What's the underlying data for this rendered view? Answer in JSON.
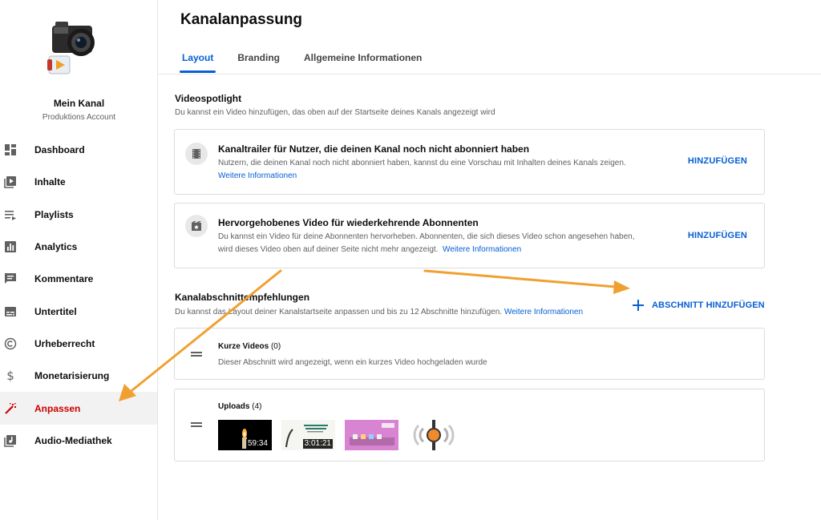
{
  "sidebar": {
    "channel_name": "Mein Kanal",
    "account_type": "Produktions Account",
    "items": [
      {
        "label": "Dashboard",
        "icon": "dashboard-icon"
      },
      {
        "label": "Inhalte",
        "icon": "video-library-icon"
      },
      {
        "label": "Playlists",
        "icon": "playlist-icon"
      },
      {
        "label": "Analytics",
        "icon": "analytics-icon"
      },
      {
        "label": "Kommentare",
        "icon": "comment-icon"
      },
      {
        "label": "Untertitel",
        "icon": "subtitles-icon"
      },
      {
        "label": "Urheberrecht",
        "icon": "copyright-icon"
      },
      {
        "label": "Monetarisierung",
        "icon": "dollar-icon"
      },
      {
        "label": "Anpassen",
        "icon": "magic-wand-icon",
        "active": true
      },
      {
        "label": "Audio-Mediathek",
        "icon": "audio-library-icon"
      }
    ]
  },
  "header": {
    "title": "Kanalanpassung",
    "tabs": [
      {
        "label": "Layout",
        "active": true
      },
      {
        "label": "Branding"
      },
      {
        "label": "Allgemeine Informationen"
      }
    ]
  },
  "spotlight": {
    "title": "Videospotlight",
    "description": "Du kannst ein Video hinzufügen, das oben auf der Startseite deines Kanals angezeigt wird",
    "cards": [
      {
        "title": "Kanaltrailer für Nutzer, die deinen Kanal noch nicht abonniert haben",
        "description": "Nutzern, die deinen Kanal noch nicht abonniert haben, kannst du eine Vorschau mit Inhalten deines Kanals zeigen.",
        "link": "Weitere Informationen",
        "button": "HINZUFÜGEN",
        "icon": "film-icon"
      },
      {
        "title": "Hervorgehobenes Video für wiederkehrende Abonnenten",
        "description_line1": "Du kannst ein Video für deine Abonnenten hervorheben. Abonnenten, die sich dieses Video schon angesehen haben,",
        "description_line2": "wird dieses Video oben auf deiner Seite nicht mehr angezeigt.",
        "link": "Weitere Informationen",
        "button": "HINZUFÜGEN",
        "icon": "featured-video-icon"
      }
    ]
  },
  "sections": {
    "title": "Kanalabschnittempfehlungen",
    "description": "Du kannst das Layout deiner Kanalstartseite anpassen und bis zu 12 Abschnitte hinzufügen.",
    "link": "Weitere Informationen",
    "add_button": "ABSCHNITT HINZUFÜGEN",
    "items": [
      {
        "title": "Kurze Videos",
        "count": "(0)",
        "description": "Dieser Abschnitt wird angezeigt, wenn ein kurzes Video hochgeladen wurde"
      },
      {
        "title": "Uploads",
        "count": "(4)",
        "videos": [
          {
            "duration": "59:34"
          },
          {
            "duration": "3:01:21"
          },
          {
            "duration": ""
          },
          {
            "duration": ""
          }
        ]
      }
    ]
  },
  "colors": {
    "accent_blue": "#065fd4",
    "active_red": "#cc0000",
    "arrow_orange": "#f0a030"
  }
}
